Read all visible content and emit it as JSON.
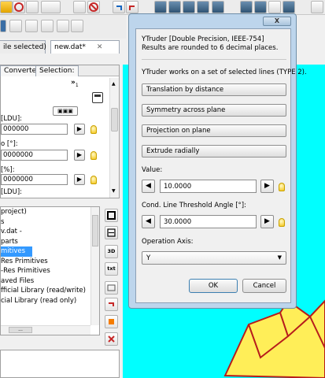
{
  "toolbar": {
    "icons": [
      "undo-icon",
      "redo-icon",
      "stop-icon",
      "new-icon",
      "open-icon",
      "cut-icon",
      "copy-icon",
      "paste-icon",
      "view-icon"
    ]
  },
  "tabs": {
    "selection_tab": "ile selected)",
    "file_tab": "new.dat*",
    "close_glyph": "✕"
  },
  "left_panel": {
    "tabs": [
      "Converter:",
      "Selection:"
    ],
    "marker": "»",
    "marker_sub": "1",
    "fields": [
      {
        "label": "[LDU]:",
        "value": "000000"
      },
      {
        "label": "o [°]:",
        "value": "0000000"
      },
      {
        "label": "[%]:",
        "value": "0000000"
      },
      {
        "label": "[LDU]:",
        "value": ""
      }
    ],
    "tree": [
      "project)",
      "s",
      "v.dat -",
      "parts",
      "mitives",
      "Res Primitives",
      "-Res Primitives",
      "aved Files",
      "fficial Library (read/write)",
      "cial Library (read only)"
    ],
    "tree_selected_index": 4,
    "side_labels": [
      "3D",
      "txt"
    ],
    "hscroll": "..."
  },
  "dialog": {
    "close_label": "X",
    "title_line1": "YTruder [Double Precision, IEEE-754]",
    "title_line2": "Results are rounded to 6 decimal places.",
    "info": "YTruder works on a set of selected lines (TYPE 2).",
    "modes": [
      "Translation by distance",
      "Symmetry across plane",
      "Projection on plane",
      "Extrude radially"
    ],
    "value_label": "Value:",
    "value": "10.0000",
    "threshold_label": "Cond. Line Threshold Angle [°]:",
    "threshold": "30.0000",
    "axis_label": "Operation Axis:",
    "axis": "Y",
    "ok_label": "OK",
    "cancel_label": "Cancel",
    "left_arrow": "◀",
    "right_arrow": "▶"
  },
  "colors": {
    "viewport": "#00ffff",
    "shape_fill": "#ffee58",
    "shape_edge": "#b71c1c",
    "selection": "#3399ff"
  }
}
